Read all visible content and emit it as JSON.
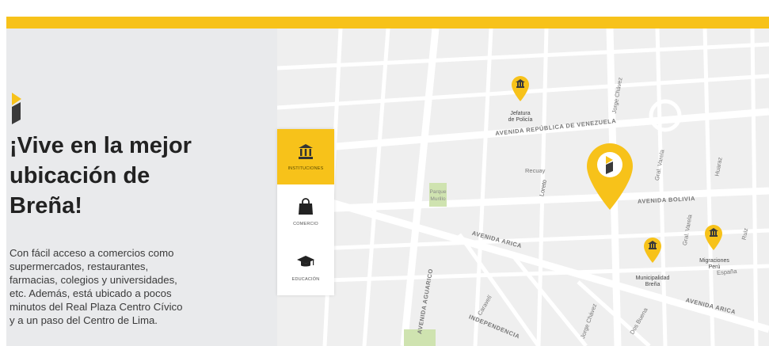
{
  "hero": {
    "headline_line1": "¡Vive en la mejor",
    "headline_line2": "ubicación de",
    "headline_line3": "Breña!",
    "description_lines": [
      "Con fácil acceso a comercios como",
      "supermercados, restaurantes,",
      "farmacias, colegios y universidades,",
      "etc. Además, está ubicado a pocos",
      "minutos del Real Plaza Centro Cívico",
      "y a un paso del Centro de Lima."
    ]
  },
  "categories": [
    {
      "label": "INSTITUCIONES",
      "icon": "institution-icon",
      "active": true
    },
    {
      "label": "COMERCIO",
      "icon": "shopping-bag-icon",
      "active": false
    },
    {
      "label": "EDUCACIÓN",
      "icon": "graduation-cap-icon",
      "active": false
    }
  ],
  "map": {
    "streets": {
      "av_venezuela": "AVENIDA REPÚBLICA DE VENEZUELA",
      "av_bolivia": "AVENIDA BOLIVIA",
      "av_arica_1": "AVENIDA ARICA",
      "av_arica_2": "AVENIDA ARICA",
      "av_aguarico": "AVENIDA AGUARICO",
      "independencia": "INDEPENDENCIA",
      "jorge_chavez_1": "Jorge Chávez",
      "jorge_chavez_2": "Jorge Chávez",
      "recuay": "Recuay",
      "loreto": "Loreto",
      "gral_varela": "Gral. Varela",
      "huaraz": "Huaraz",
      "ruiz": "Ruiz",
      "caravelí": "Caravelí",
      "dos_buena": "Dos Buena",
      "espana": "España",
      "gral_varela_2": "Gral. Varela"
    },
    "park_label": "Parque\nMurillo",
    "pois": [
      {
        "label_line1": "Jefatura",
        "label_line2": "de Policía",
        "icon": "institution-icon"
      },
      {
        "label_line1": "Municipalidad",
        "label_line2": "Breña",
        "icon": "institution-icon"
      },
      {
        "label_line1": "Migraciones",
        "label_line2": "Perú",
        "icon": "institution-icon"
      },
      {
        "label_line1": "",
        "label_line2": "",
        "icon": "institution-icon"
      }
    ],
    "main_pin_icon": "brand-logo-icon"
  },
  "colors": {
    "accent": "#f7c21a",
    "panel": "#e9eaec",
    "map_bg": "#efefef",
    "road": "#ffffff",
    "text_dark": "#222222"
  }
}
